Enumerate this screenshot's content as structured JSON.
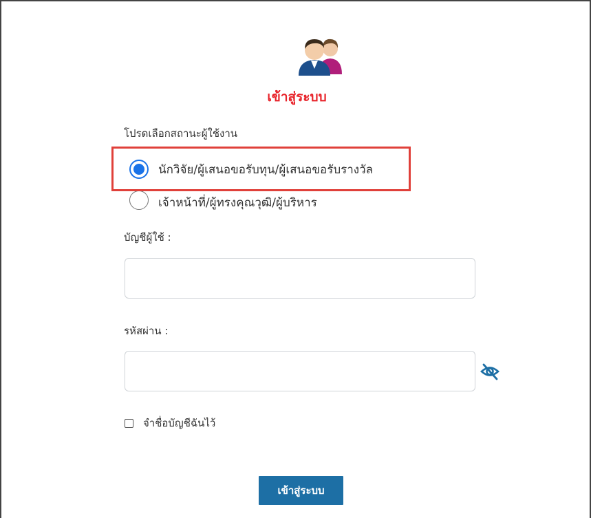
{
  "login": {
    "title": "เข้าสู่ระบบ",
    "role_prompt": "โปรดเลือกสถานะผู้ใช้งาน",
    "roles": [
      {
        "label": "นักวิจัย/ผู้เสนอขอรับทุน/ผู้เสนอขอรับรางวัล",
        "checked": true
      },
      {
        "label": "เจ้าหน้าที่/ผู้ทรงคุณวุฒิ/ผู้บริหาร",
        "checked": false
      }
    ],
    "username_label": "บัญชีผู้ใช้ :",
    "username_value": "",
    "password_label": "รหัสผ่าน :",
    "password_value": "",
    "remember_label": "จำชื่อบัญชีฉันไว้",
    "remember_checked": false,
    "submit_label": "เข้าสู่ระบบ"
  },
  "colors": {
    "title": "#e8232a",
    "radio_selected": "#1a73e8",
    "highlight_box": "#e0403a",
    "submit_button": "#1d6fa5",
    "eye_icon": "#1d6fa5"
  },
  "icons": {
    "avatar": "users-avatar-icon",
    "password_toggle": "eye-slash-icon"
  }
}
